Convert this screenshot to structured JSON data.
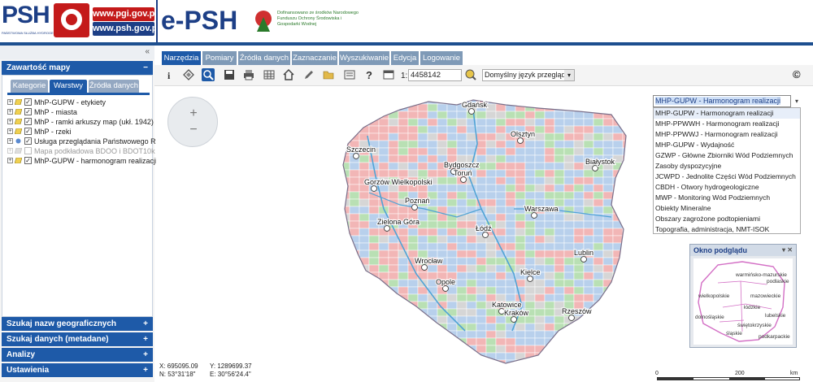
{
  "header": {
    "logo_text": "PSH",
    "logo_subtitle": "PAŃSTWOWA SŁUŻBA HYDROGEOLOGICZNA",
    "url1": "www.pgi.gov.pl",
    "url2": "www.psh.gov.pl",
    "app_title": "e-PSH",
    "sponsor_text": "Dofinansowano ze środków Narodowego Funduszu Ochrony Środowiska i Gospodarki Wodnej"
  },
  "left_panel": {
    "contents_title": "Zawartość mapy",
    "tabs": [
      "Kategorie",
      "Warstwy",
      "Źródła danych"
    ],
    "active_tab": 1,
    "layers": [
      {
        "label": "MhP-GUPW - etykiety",
        "checked": true,
        "dim": false
      },
      {
        "label": "MhP - miasta",
        "checked": true,
        "dim": false
      },
      {
        "label": "MhP - ramki arkuszy map (ukł. 1942)",
        "checked": true,
        "dim": false
      },
      {
        "label": "MhP - rzeki",
        "checked": true,
        "dim": false
      },
      {
        "label": "Usługa przeglądania Państwowego Re",
        "checked": true,
        "dim": false
      },
      {
        "label": "Mapa podkładowa BDOO i BDOT10k",
        "checked": false,
        "dim": true
      },
      {
        "label": "MhP-GUPW - harmonogram realizacji",
        "checked": true,
        "dim": false
      }
    ],
    "sections": [
      "Szukaj nazw geograficznych",
      "Szukaj danych (metadane)",
      "Analizy",
      "Ustawienia"
    ],
    "collapse_icon": "chevron-double-left-icon"
  },
  "menu": {
    "items": [
      "Narzędzia",
      "Pomiary",
      "Źródła danych",
      "Zaznaczanie",
      "Wyszukiwanie",
      "Edycja",
      "Logowanie"
    ],
    "active": 0
  },
  "toolbar": {
    "icons": [
      "info-icon",
      "layers-icon",
      "zoom-icon",
      "save-icon",
      "print-icon",
      "grid-icon",
      "home-icon",
      "pencil-icon",
      "folder-icon",
      "legend-icon",
      "help-icon",
      "window-icon"
    ],
    "scale_prefix": "1:",
    "scale_value": "4458142",
    "language": "Domyślny język przeglądar",
    "copyright_symbol": "©"
  },
  "map": {
    "layer_dropdown": {
      "selected": "MHP-GUPW - Harmonogram realizacji",
      "options": [
        "MHP-GUPW - Harmonogram realizacji",
        "MHP-PPWWH - Harmonogram realizacji",
        "MHP-PPWWJ - Harmonogram realizacji",
        "MHP-GUPW - Wydajność",
        "GZWP - Główne Zbiorniki Wód Podziemnych",
        "Zasoby dyspozycyjne",
        "JCWPD - Jednolite Części Wód Podziemnych",
        "CBDH - Otwory hydrogeologiczne",
        "MWP - Monitoring Wód Podziemnych",
        "Obiekty Mineralne",
        "Obszary zagrożone podtopieniami",
        "Topografia, administracja, NMT-ISOK"
      ]
    },
    "cities": [
      "Gdańsk",
      "Olsztyn",
      "Szczecin",
      "Bydgoszcz",
      "Toruń",
      "Białystok",
      "Gorzów Wielkopolski",
      "Poznań",
      "Warszawa",
      "Zielona Góra",
      "Łódź",
      "Lublin",
      "Wrocław",
      "Opole",
      "Kielce",
      "Katowice",
      "Kraków",
      "Rzeszów"
    ],
    "preview": {
      "title": "Okno podglądu",
      "regions": [
        "warmińsko-mazurskie",
        "podlaskie",
        "wielkopolskie",
        "mazowieckie",
        "łódzkie",
        "dolnośląskie",
        "lubelskie",
        "świętokrzyskie",
        "śląskie",
        "podkarpackie"
      ]
    },
    "coords": {
      "x_label": "X: 695095.09",
      "y_label": "Y: 1289699.37",
      "n_label": "N: 53°31'18\"",
      "e_label": "E: 30°56'24.4\""
    },
    "scalebar": {
      "labels": [
        "0",
        "200",
        "km"
      ]
    }
  },
  "colors": {
    "brand_blue": "#1d3f86",
    "accent_blue": "#1e5aa8",
    "brand_red": "#c41a1a",
    "tile_red": "#f2b6b6",
    "tile_blue": "#b8d0ec",
    "tile_green": "#b9e0b4",
    "tile_gray": "#d6d6d6"
  }
}
